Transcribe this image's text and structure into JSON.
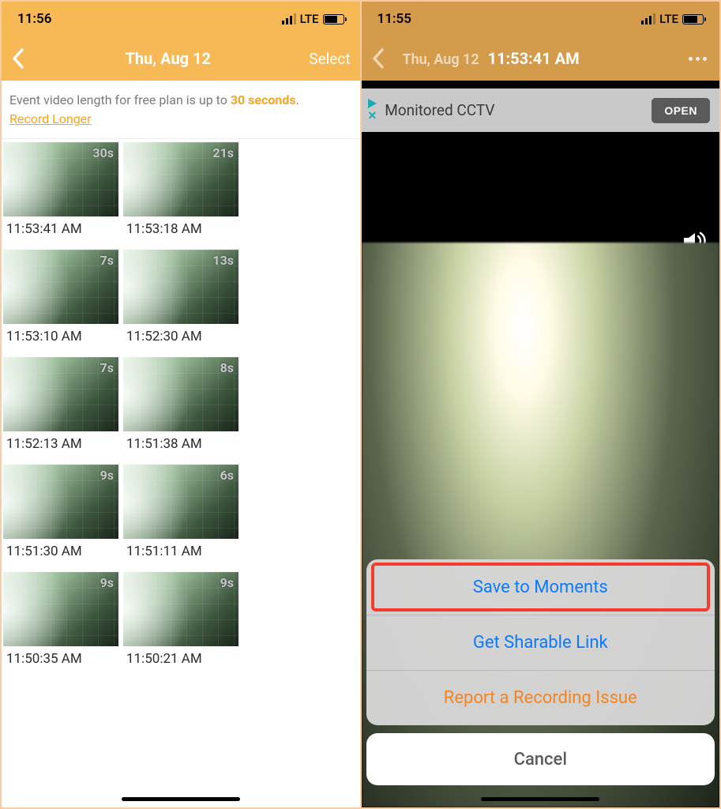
{
  "left": {
    "status_time": "11:56",
    "network_label": "LTE",
    "nav_title": "Thu, Aug 12",
    "nav_select": "Select",
    "banner_prefix": "Event video length for free plan is up to ",
    "banner_highlight": "30 seconds",
    "banner_suffix": ".",
    "banner_link": "Record Longer",
    "events": [
      {
        "duration": "30s",
        "time": "11:53:41 AM"
      },
      {
        "duration": "21s",
        "time": "11:53:18 AM"
      },
      {
        "duration": "7s",
        "time": "11:53:10 AM"
      },
      {
        "duration": "13s",
        "time": "11:52:30 AM"
      },
      {
        "duration": "7s",
        "time": "11:52:13 AM"
      },
      {
        "duration": "8s",
        "time": "11:51:38 AM"
      },
      {
        "duration": "9s",
        "time": "11:51:30 AM"
      },
      {
        "duration": "6s",
        "time": "11:51:11 AM"
      },
      {
        "duration": "9s",
        "time": "11:50:35 AM"
      },
      {
        "duration": "9s",
        "time": "11:50:21 AM"
      }
    ]
  },
  "right": {
    "status_time": "11:55",
    "network_label": "LTE",
    "nav_date": "Thu, Aug 12",
    "nav_time": "11:53:41 AM",
    "ad_text": "Monitored CCTV",
    "ad_cta": "OPEN",
    "sheet": {
      "save": "Save to Moments",
      "share": "Get Sharable Link",
      "report": "Report a Recording Issue",
      "cancel": "Cancel"
    }
  }
}
